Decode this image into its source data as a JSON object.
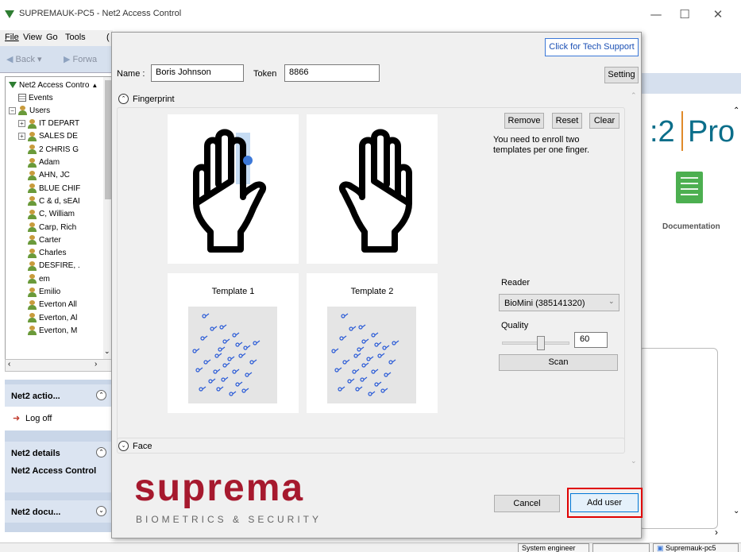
{
  "window": {
    "title": "SUPREMAUK-PC5 - Net2 Access Control",
    "minimize_glyph": "—",
    "maximize_glyph": "☐",
    "close_glyph": "✕"
  },
  "menu": {
    "file": "File",
    "view": "View",
    "go": "Go",
    "tools": "Tools",
    "extra": "("
  },
  "nav": {
    "back": "Back ▾",
    "forward": "Forwa"
  },
  "tree": {
    "root": "Net2 Access Contro",
    "items": [
      {
        "label": "Events",
        "type": "events",
        "indent": 1
      },
      {
        "label": "Users",
        "type": "group",
        "indent": 0,
        "expander": "⊟"
      },
      {
        "label": "IT DEPART",
        "type": "group",
        "indent": 1,
        "expander": "⊞"
      },
      {
        "label": "SALES DE",
        "type": "group",
        "indent": 1,
        "expander": "⊞"
      },
      {
        "label": "2 CHRIS G",
        "type": "user",
        "indent": 2
      },
      {
        "label": "Adam",
        "type": "user",
        "indent": 2
      },
      {
        "label": "AHN, JC",
        "type": "user",
        "indent": 2
      },
      {
        "label": "BLUE CHIF",
        "type": "user",
        "indent": 2
      },
      {
        "label": "C & d, sEAI",
        "type": "user",
        "indent": 2
      },
      {
        "label": "C, William",
        "type": "user",
        "indent": 2
      },
      {
        "label": "Carp, Rich",
        "type": "user",
        "indent": 2
      },
      {
        "label": "Carter",
        "type": "user",
        "indent": 2
      },
      {
        "label": "Charles",
        "type": "user",
        "indent": 2
      },
      {
        "label": "DESFIRE, .",
        "type": "user",
        "indent": 2
      },
      {
        "label": "em",
        "type": "user",
        "indent": 2
      },
      {
        "label": "Emilio",
        "type": "user",
        "indent": 2
      },
      {
        "label": "Everton All",
        "type": "user",
        "indent": 2
      },
      {
        "label": "Everton, Al",
        "type": "user",
        "indent": 2
      },
      {
        "label": "Everton, M",
        "type": "user",
        "indent": 2
      }
    ]
  },
  "left_panels": {
    "actions_title": "Net2 actio...",
    "logoff": "Log off",
    "details_title": "Net2 details",
    "details_body": "Net2 Access Control",
    "docs_title": "Net2 docu..."
  },
  "background": {
    "brand_prefix": ":2",
    "brand_suffix": "Pro",
    "documentation": "Documentation"
  },
  "status": {
    "role": "System engineer",
    "computer": "Supremauk-pc5"
  },
  "dialog": {
    "tech_support": "Click for Tech Support",
    "name_label": "Name :",
    "name_value": "Boris Johnson",
    "token_label": "Token",
    "token_value": "8866",
    "setting": "Setting",
    "fingerprint_section": "Fingerprint",
    "remove": "Remove",
    "reset": "Reset",
    "clear": "Clear",
    "enroll_hint": "You need to enroll two templates per one finger.",
    "template1": "Template 1",
    "template2": "Template 2",
    "reader_label": "Reader",
    "reader_value": "BioMini (385141320)",
    "quality_label": "Quality",
    "quality_value": "60",
    "scan": "Scan",
    "face_section": "Face",
    "logo_main": "suprema",
    "logo_tagline": "BIOMETRICS & SECURITY",
    "cancel": "Cancel",
    "add_user": "Add user"
  },
  "colors": {
    "logo_red": "#a6192e",
    "highlight_red": "#e00000",
    "accent_blue": "#3c78d8",
    "brand_teal": "#0b6e8a"
  }
}
